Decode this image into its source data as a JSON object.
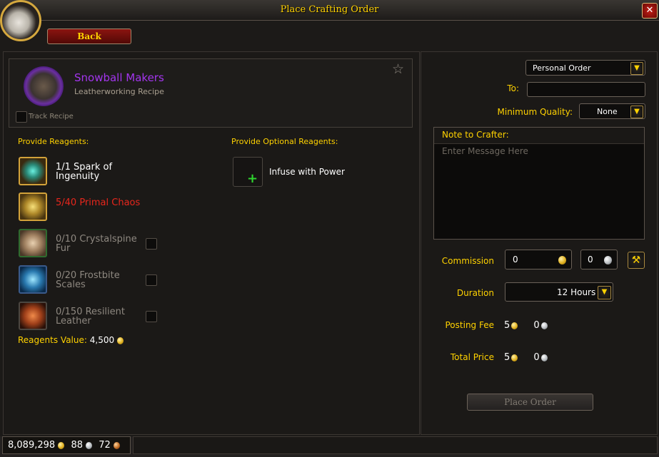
{
  "window": {
    "title": "Place Crafting Order",
    "close_label": "✕"
  },
  "back_label": "Back",
  "recipe": {
    "name": "Snowball Makers",
    "subtitle": "Leatherworking Recipe",
    "track_label": "Track Recipe"
  },
  "reagents": {
    "provide_label": "Provide Reagents:",
    "optional_label": "Provide Optional Reagents:",
    "items": [
      {
        "label": "1/1 Spark of Ingenuity",
        "status": "white",
        "icon": "spark-of-ingenuity-icon",
        "checkbox": false
      },
      {
        "label": "5/40 Primal Chaos",
        "status": "red",
        "icon": "primal-chaos-icon",
        "checkbox": false
      },
      {
        "label": "0/10 Crystalspine Fur",
        "status": "gray",
        "icon": "crystalspine-fur-icon",
        "checkbox": true
      },
      {
        "label": "0/20 Frostbite Scales",
        "status": "gray",
        "icon": "frostbite-scales-icon",
        "checkbox": true
      },
      {
        "label": "0/150 Resilient Leather",
        "status": "gray",
        "icon": "resilient-leather-icon",
        "checkbox": true
      }
    ],
    "value_label": "Reagents Value:",
    "value": "4,500",
    "optional_slot_label": "Infuse with Power"
  },
  "order": {
    "type_value": "Personal Order",
    "to_label": "To:",
    "to_value": "",
    "min_quality_label": "Minimum Quality:",
    "min_quality_value": "None",
    "note_label": "Note to Crafter:",
    "note_placeholder": "Enter Message Here",
    "commission_label": "Commission",
    "commission_gold": "0",
    "commission_silver": "0",
    "duration_label": "Duration",
    "duration_value": "12 Hours",
    "posting_fee_label": "Posting Fee",
    "posting_fee_gold": "5",
    "posting_fee_silver": "0",
    "total_price_label": "Total Price",
    "total_price_gold": "5",
    "total_price_silver": "0",
    "place_order_label": "Place Order"
  },
  "money": {
    "gold": "8,089,298",
    "silver": "88",
    "copper": "72"
  },
  "colors": {
    "gold_text": "#ffd200",
    "epic": "#a335ee",
    "insufficient": "#e8261c"
  }
}
